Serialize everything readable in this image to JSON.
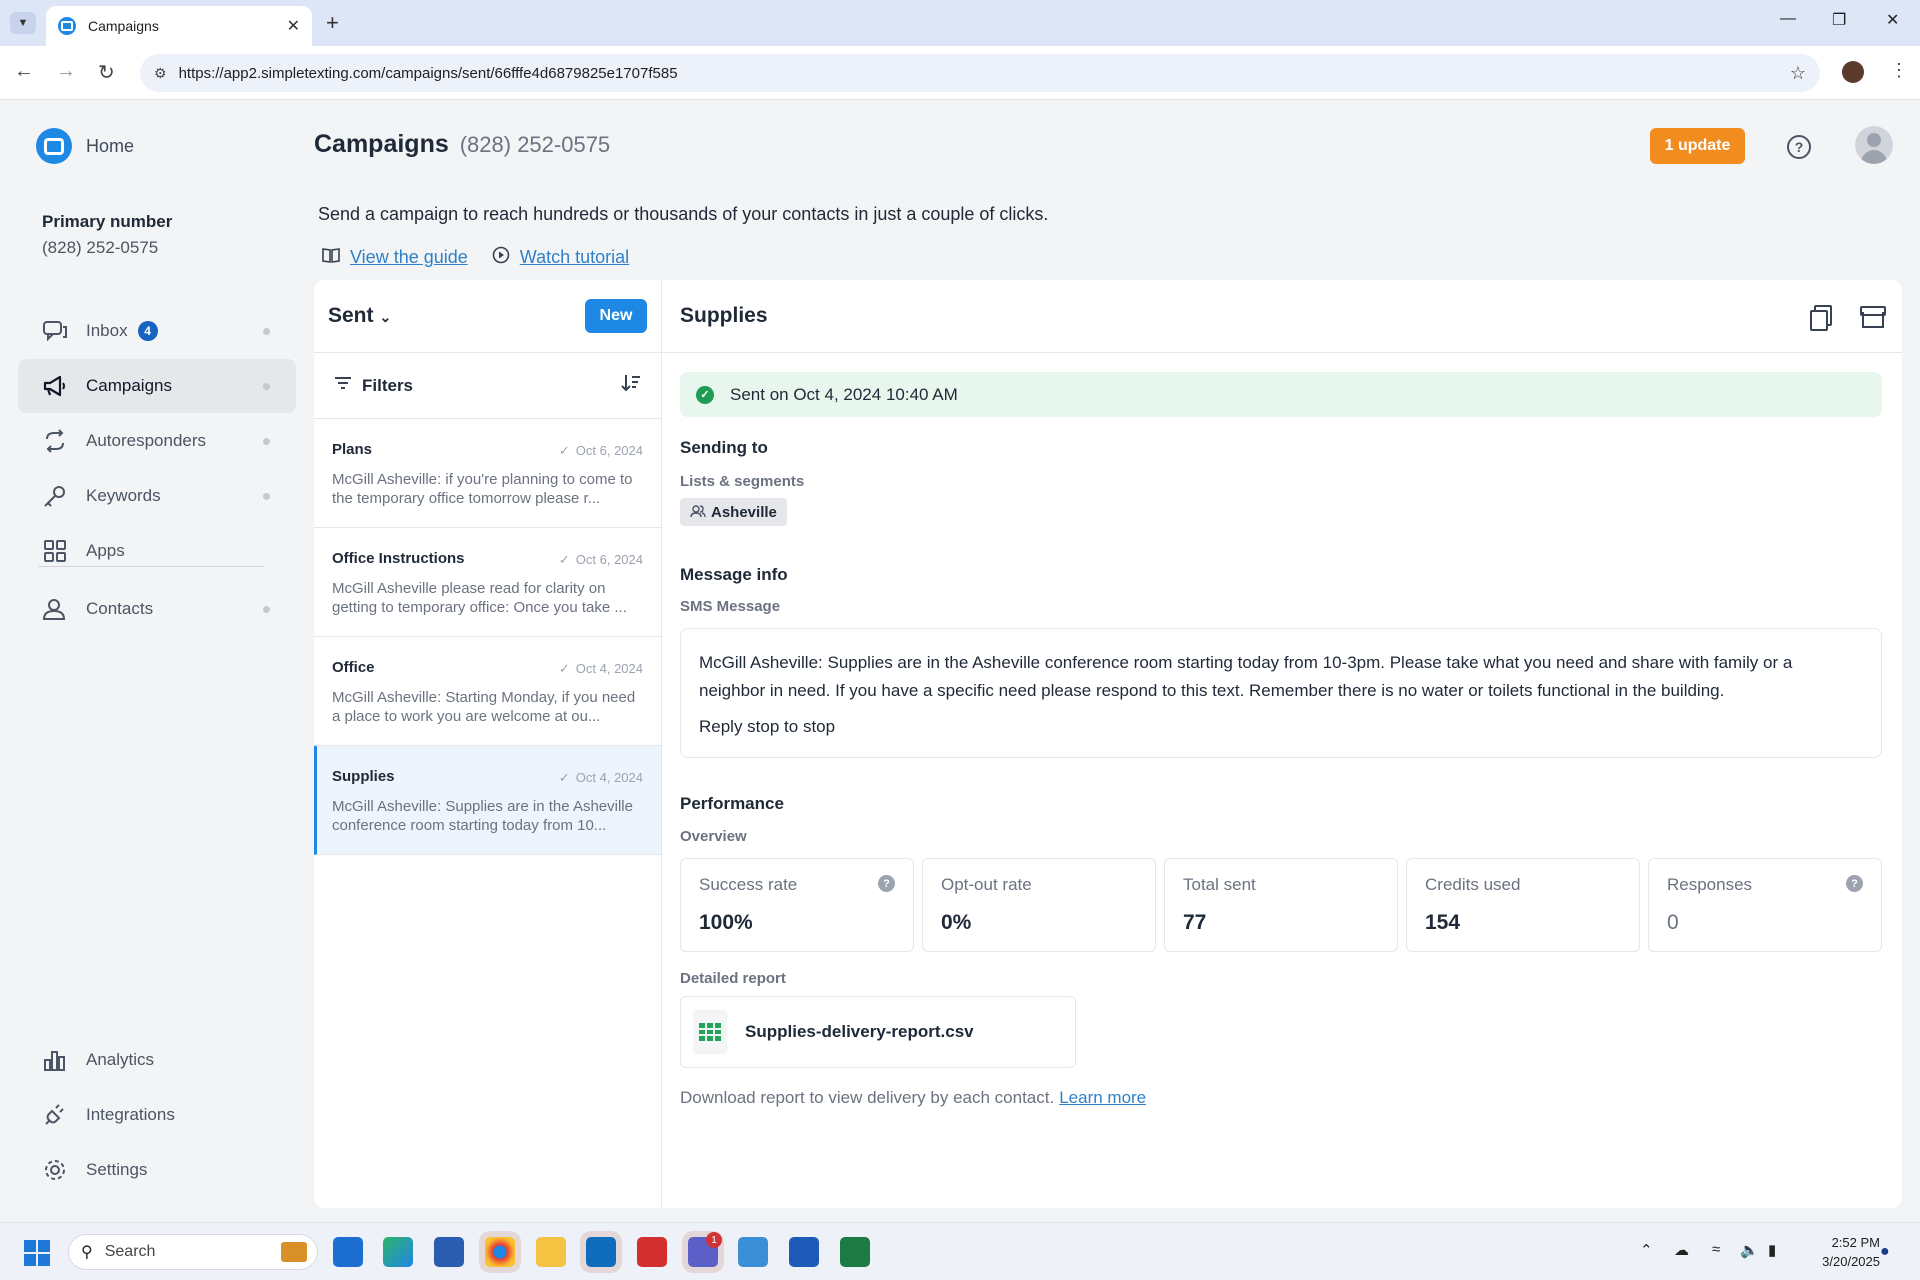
{
  "browser": {
    "tab_title": "Campaigns",
    "url": "https://app2.simpletexting.com/campaigns/sent/66fffe4d6879825e1707f585"
  },
  "sidebar": {
    "home_label": "Home",
    "primary_label": "Primary number",
    "primary_number": "(828) 252-0575",
    "items": [
      {
        "label": "Inbox",
        "badge": "4",
        "icon": "chat-bubbles-icon"
      },
      {
        "label": "Campaigns",
        "icon": "megaphone-icon",
        "active": true
      },
      {
        "label": "Autoresponders",
        "icon": "autoresponder-arrows-icon"
      },
      {
        "label": "Keywords",
        "icon": "key-icon"
      },
      {
        "label": "Apps",
        "icon": "apps-grid-icon"
      },
      {
        "label": "Contacts",
        "icon": "contacts-icon"
      }
    ],
    "bottom_items": [
      {
        "label": "Analytics",
        "icon": "bar-chart-icon"
      },
      {
        "label": "Integrations",
        "icon": "plug-icon"
      },
      {
        "label": "Settings",
        "icon": "gear-icon"
      }
    ]
  },
  "header": {
    "title": "Campaigns",
    "phone": "(828) 252-0575",
    "update_label": "1 update",
    "intro": "Send a campaign to reach hundreds or thousands of your contacts in just a couple of clicks.",
    "guide_link": "View the guide",
    "tutorial_link": "Watch tutorial"
  },
  "list": {
    "folder": "Sent",
    "new_label": "New",
    "filters_label": "Filters",
    "campaigns": [
      {
        "title": "Plans",
        "date": "Oct 6, 2024",
        "body": "McGill Asheville: if you're planning to come to the temporary office tomorrow please r..."
      },
      {
        "title": "Office Instructions",
        "date": "Oct 6, 2024",
        "body": "McGill Asheville please read for clarity on getting to temporary office: Once you take ..."
      },
      {
        "title": "Office",
        "date": "Oct 4, 2024",
        "body": "McGill Asheville: Starting Monday, if you need a place to work you are welcome at ou..."
      },
      {
        "title": "Supplies",
        "date": "Oct 4, 2024",
        "body": "McGill Asheville: Supplies are in the Asheville conference room starting today from 10..."
      }
    ]
  },
  "detail": {
    "title": "Supplies",
    "sent_status": "Sent on Oct 4, 2024 10:40 AM",
    "sending_to_title": "Sending to",
    "lists_label": "Lists & segments",
    "segment": "Asheville",
    "message_info_title": "Message info",
    "message_type": "SMS Message",
    "message_text": "McGill Asheville: Supplies are in the Asheville conference room starting today from 10-3pm. Please take what you need and share with family or a neighbor in need. If you have a specific need please respond to this text. Remember there is no water or toilets functional in the building.",
    "message_stop": "Reply stop to stop",
    "performance_title": "Performance",
    "overview_label": "Overview",
    "metrics": [
      {
        "label": "Success rate",
        "value": "100%"
      },
      {
        "label": "Opt-out rate",
        "value": "0%"
      },
      {
        "label": "Total sent",
        "value": "77"
      },
      {
        "label": "Credits used",
        "value": "154"
      },
      {
        "label": "Responses",
        "value": "0"
      }
    ],
    "report_label": "Detailed report",
    "report_file": "Supplies-delivery-report.csv",
    "report_note": "Download report to view delivery by each contact.",
    "learn_more": "Learn more"
  },
  "taskbar": {
    "search_placeholder": "Search",
    "teams_badge": "1",
    "time": "2:52 PM",
    "date": "3/20/2025"
  },
  "colors": {
    "accent": "#1e88e5",
    "update": "#f28c1e",
    "success": "#1f9d55"
  }
}
